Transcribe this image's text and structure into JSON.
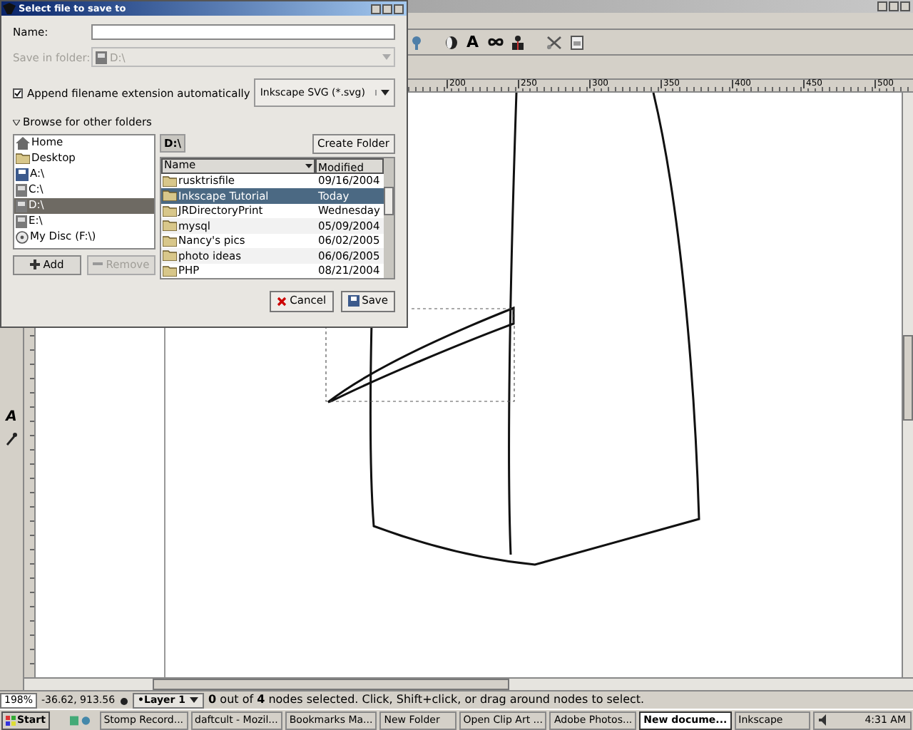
{
  "ruler": {
    "labels": [
      "200",
      "250",
      "300",
      "350",
      "400",
      "450",
      "500"
    ]
  },
  "toolbar_glyph": "A",
  "toolbox": [
    {
      "kind": "glyph",
      "glyph": "A"
    },
    {
      "kind": "dropper"
    }
  ],
  "status_bar": {
    "zoom": "198%",
    "coords": "-36.62, 913.56",
    "layer": "•Layer 1",
    "message": "**0** out of **4** nodes selected. Click, Shift+click, or drag around nodes to select."
  },
  "taskbar": {
    "start": "Start",
    "items": [
      {
        "label": "Stomp Record...",
        "selected": false
      },
      {
        "label": "daftcult - Mozil...",
        "selected": false
      },
      {
        "label": "Bookmarks Ma...",
        "selected": false
      },
      {
        "label": "New Folder",
        "selected": false
      },
      {
        "label": "Open Clip Art ...",
        "selected": false
      },
      {
        "label": "Adobe Photos...",
        "selected": false
      },
      {
        "label": "New docume...",
        "selected": true
      },
      {
        "label": "Inkscape",
        "selected": false
      }
    ],
    "clock": "4:31 AM"
  },
  "dialog": {
    "title": "Select file to save to",
    "name": {
      "label": "Name:"
    },
    "save_in_folder": {
      "label": "Save in folder:",
      "value": "D:\\",
      "disabled": true
    },
    "append_extension": {
      "label": "Append filename extension automatically",
      "checked": true
    },
    "file_type": "Inkscape SVG (*.svg)",
    "browse": {
      "label": "Browse for other folders",
      "expanded": true
    },
    "places": [
      {
        "label": "Home",
        "kind": "home",
        "selected": false
      },
      {
        "label": "Desktop",
        "kind": "folder",
        "selected": false
      },
      {
        "label": "A:\\",
        "kind": "floppy",
        "selected": false
      },
      {
        "label": "C:\\",
        "kind": "drive",
        "selected": false
      },
      {
        "label": "D:\\",
        "kind": "drive",
        "selected": true
      },
      {
        "label": "E:\\",
        "kind": "drive",
        "selected": false
      },
      {
        "label": "My Disc (F:\\)",
        "kind": "disc",
        "selected": false
      }
    ],
    "add_button": "Add",
    "remove_button": {
      "label": "Remove",
      "disabled": true
    },
    "path_button": "D:\\",
    "create_folder": "Create Folder",
    "columns": [
      "Name",
      "Modified"
    ],
    "files": [
      {
        "name": "rusktrisfile",
        "modified": "09/16/2004",
        "selected": false
      },
      {
        "name": "Inkscape Tutorial",
        "modified": "Today",
        "selected": true
      },
      {
        "name": "JRDirectoryPrint",
        "modified": "Wednesday",
        "selected": false
      },
      {
        "name": "mysql",
        "modified": "05/09/2004",
        "selected": false
      },
      {
        "name": "Nancy's pics",
        "modified": "06/02/2005",
        "selected": false
      },
      {
        "name": "photo ideas",
        "modified": "06/06/2005",
        "selected": false
      },
      {
        "name": "PHP",
        "modified": "08/21/2004",
        "selected": false
      }
    ],
    "cancel": "Cancel",
    "save": "Save"
  }
}
